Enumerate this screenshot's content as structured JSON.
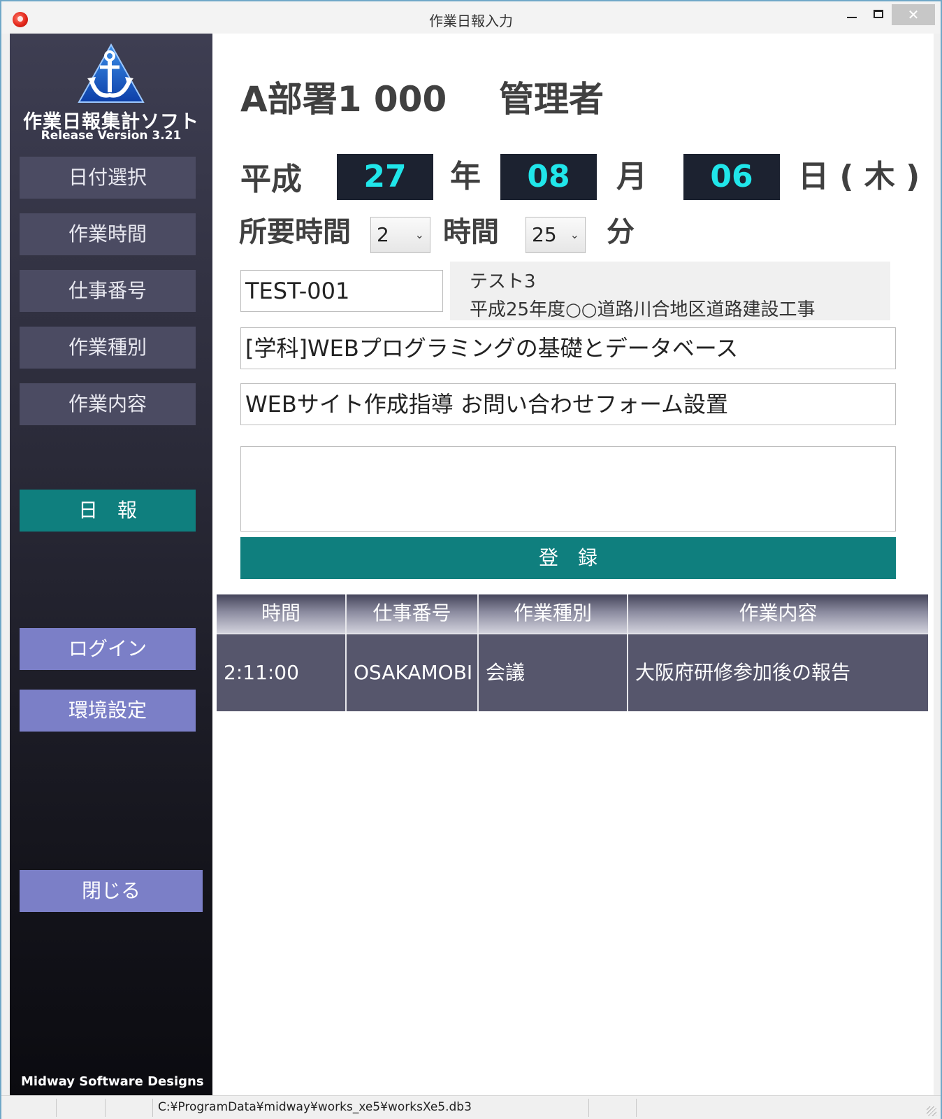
{
  "window": {
    "title": "作業日報入力"
  },
  "sidebar": {
    "app_name": "作業日報集計ソフト",
    "version": "Release Version 3.21",
    "nav": {
      "date_select": "日付選択",
      "work_time": "作業時間",
      "job_number": "仕事番号",
      "work_type": "作業種別",
      "work_content": "作業内容",
      "daily_report": "日　報",
      "login": "ログイン",
      "settings": "環境設定",
      "close": "閉じる"
    },
    "footer": "Midway Software Designs"
  },
  "header": {
    "department": "A部署1 000",
    "role": "管理者"
  },
  "date": {
    "era": "平成",
    "year": "27",
    "year_unit": "年",
    "month": "08",
    "month_unit": "月",
    "day": "06",
    "day_unit": "日 ( 木 )"
  },
  "duration": {
    "label": "所要時間",
    "hours": "2",
    "hours_unit": "時間",
    "minutes": "25",
    "minutes_unit": "分"
  },
  "job": {
    "number": "TEST-001",
    "name": "テスト3",
    "description": "平成25年度○○道路川合地区道路建設工事"
  },
  "work_type_value": "[学科]WEBプログラミングの基礎とデータベース",
  "work_content_value": "WEBサイト作成指導 お問い合わせフォーム設置",
  "register_label": "登　録",
  "table": {
    "columns": [
      "時間",
      "仕事番号",
      "作業種別",
      "作業内容"
    ],
    "rows": [
      [
        "2:11:00",
        "OSAKAMOBI",
        "会議",
        "大阪府研修参加後の報告"
      ]
    ]
  },
  "statusbar": {
    "path": "C:¥ProgramData¥midway¥works_xe5¥worksXe5.db3"
  },
  "colors": {
    "accent_teal": "#0f7f7e",
    "date_digits": "#20e6ea",
    "nav_purple": "#7b7fc7"
  }
}
